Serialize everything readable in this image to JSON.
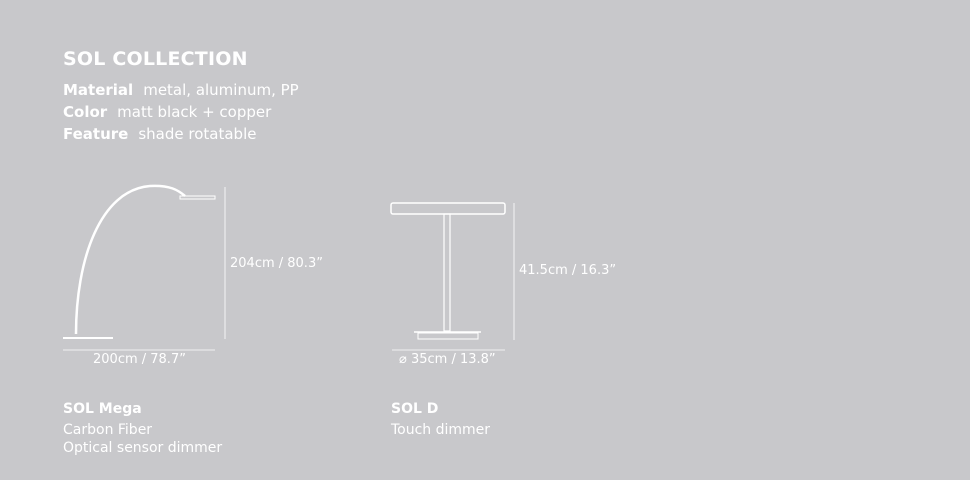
{
  "collection": {
    "title": "SOL COLLECTION",
    "specs": [
      {
        "label": "Material",
        "value": "metal, aluminum, PP"
      },
      {
        "label": "Color",
        "value": "matt black + copper"
      },
      {
        "label": "Feature",
        "value": "shade rotatable"
      }
    ]
  },
  "products": [
    {
      "name": "SOL  Mega",
      "height": "204cm / 80.3”",
      "width": "200cm / 78.7”",
      "lines": [
        "Carbon Fiber",
        "Optical sensor dimmer"
      ]
    },
    {
      "name": "SOL  D",
      "height": "41.5cm / 16.3”",
      "width": "⌀ 35cm / 13.8”",
      "lines": [
        "Touch dimmer"
      ]
    }
  ],
  "colors": {
    "background": "#c8c8cb",
    "foreground": "#ffffff"
  }
}
